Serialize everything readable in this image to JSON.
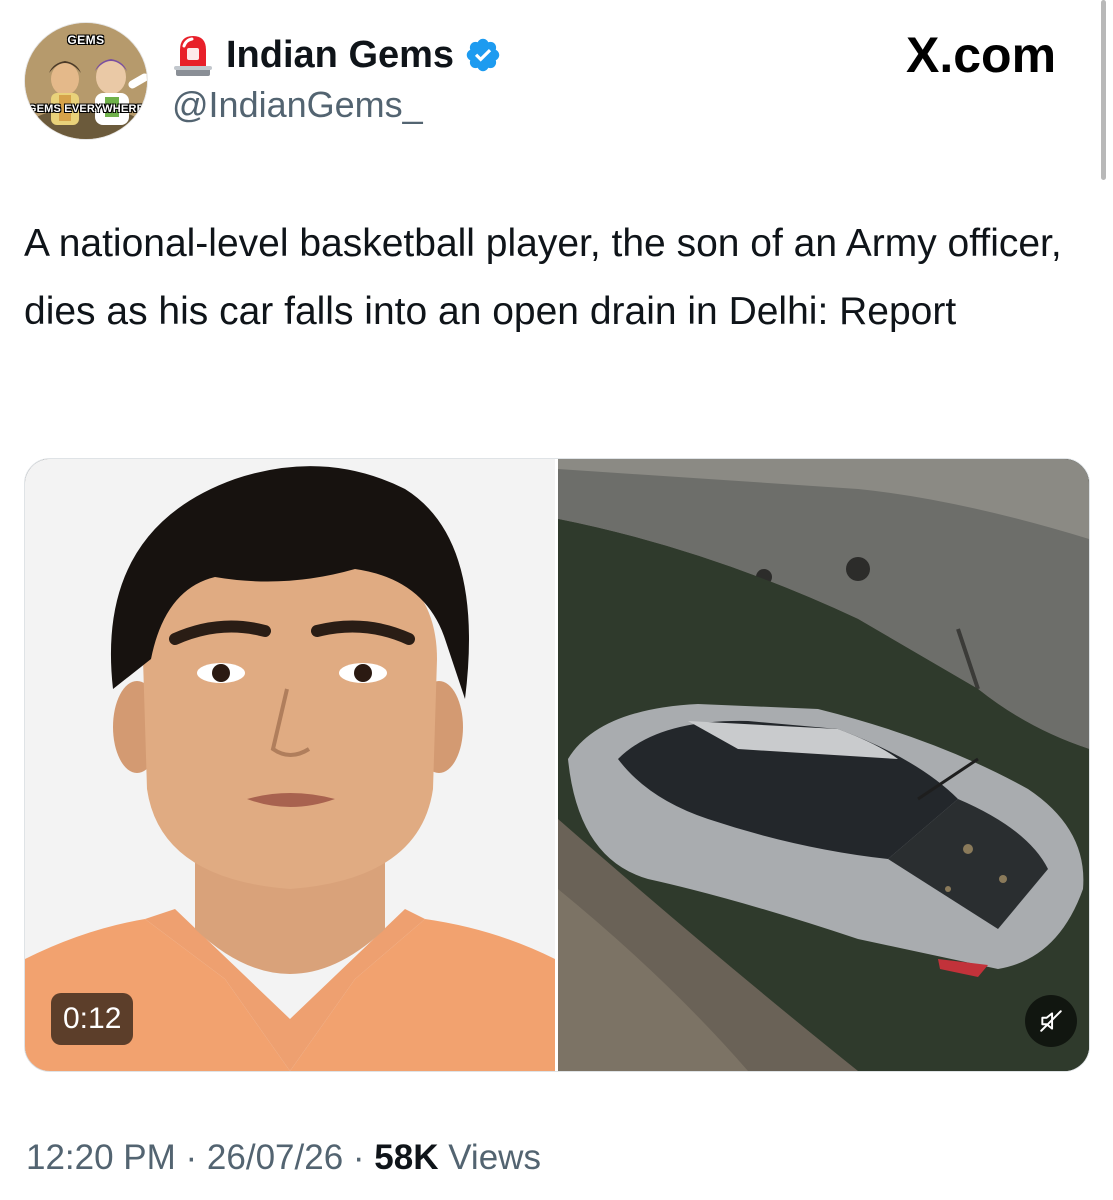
{
  "author": {
    "avatar_top_text": "GEMS",
    "avatar_bottom_text": "GEMS EVERYWHERE",
    "display_name": "Indian Gems",
    "handle": "@IndianGems_",
    "verified": true,
    "name_prefix_icon": "police-siren-emoji",
    "badge_icon": "verified-badge-icon"
  },
  "brand": "X.com",
  "tweet": {
    "text": "A national-level basketball player, the son of an Army officer, dies as his car falls into an open drain in Delhi: Report"
  },
  "media": {
    "left_image": "portrait-photo",
    "right_image": "submerged-car-photo",
    "duration": "0:12",
    "mute_icon": "muted-speaker-icon"
  },
  "meta": {
    "time": "12:20 PM",
    "sep1": " · ",
    "date": "26/07/26",
    "sep2": " · ",
    "views_count": "58K",
    "views_label": " Views"
  },
  "colors": {
    "verified_blue": "#1d9bf0",
    "secondary_text": "#536471",
    "primary_text": "#0f1419",
    "siren_red": "#e8202a"
  }
}
